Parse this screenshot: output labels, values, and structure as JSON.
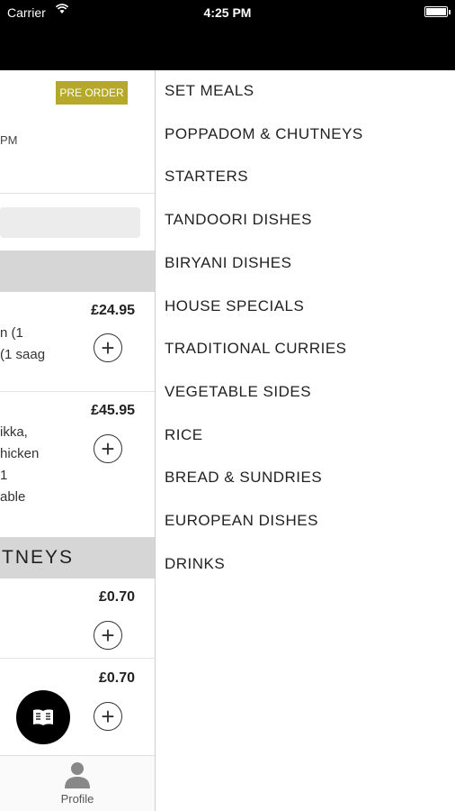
{
  "status_bar": {
    "carrier": "Carrier",
    "time": "4:25 PM"
  },
  "left_panel": {
    "preorder_label": "PRE ORDER",
    "time_fragment": "PM",
    "items": [
      {
        "text_lines": [
          "n (1",
          "(1 saag"
        ],
        "price": "£24.95"
      },
      {
        "text_lines": [
          "ikka,",
          "hicken",
          "1",
          "able"
        ],
        "price": "£45.95"
      },
      {
        "text_lines": [],
        "price": "£0.70"
      },
      {
        "text_lines": [],
        "price": "£0.70"
      }
    ],
    "category_fragment": "TNEYS",
    "tab_profile_label": "Profile"
  },
  "menu": {
    "items": [
      "SET MEALS",
      "POPPADOM & CHUTNEYS",
      "STARTERS",
      "TANDOORI DISHES",
      "BIRYANI DISHES",
      "HOUSE SPECIALS",
      "TRADITIONAL CURRIES",
      "VEGETABLE SIDES",
      "RICE",
      "BREAD & SUNDRIES",
      "EUROPEAN DISHES",
      "DRINKS"
    ]
  },
  "colors": {
    "header": "#000000",
    "preorder": "#b5a82a",
    "band": "#d6d6d6"
  },
  "icons": [
    "wifi-icon",
    "battery-icon",
    "plus-circle-icon",
    "menu-book-icon",
    "person-icon"
  ]
}
